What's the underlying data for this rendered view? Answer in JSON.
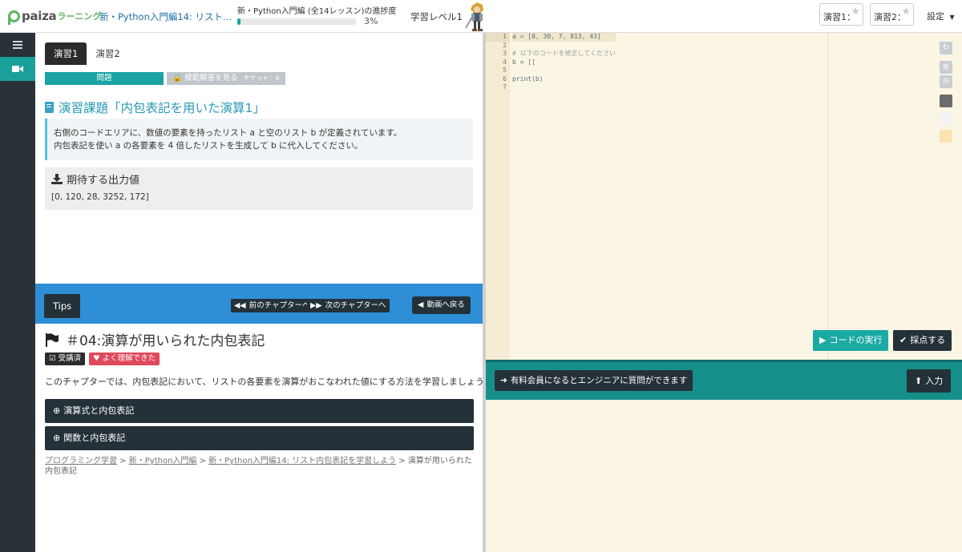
{
  "header": {
    "logo_text": "paiza",
    "logo_sub": "ラーニング",
    "course_title": "新・Python入門編14: リスト…",
    "progress_label": "新・Python入門編 (全14レッスン)の進捗度",
    "progress_percent": "3%",
    "progress_value": 0.03,
    "level_label": "学習レベル1",
    "exercise_badges": [
      "演習1：",
      "演習2："
    ],
    "settings_label": "設定"
  },
  "leftnav": {
    "icons": [
      "menu-icon",
      "video-icon"
    ]
  },
  "exercise": {
    "tabs": [
      "演習1",
      "演習2"
    ],
    "problem_label": "問題",
    "answer_label": "模範解答を見る",
    "ticket_label": "チケット：6",
    "heading": "演習課題「内包表記を用いた演算1」",
    "description_line1": "右側のコードエリアに、数値の要素を持ったリスト a と空のリスト b が定義されています。",
    "description_line2": "内包表記を使い a の各要素を 4 倍したリストを生成して b に代入してください。",
    "output_title": "期待する出力値",
    "output_value": "[0, 120, 28, 3252, 172]"
  },
  "tips": {
    "tips_label": "Tips",
    "prev_label": "前のチャプターへ",
    "next_label": "次のチャプターへ",
    "video_label": "動画へ戻る"
  },
  "chapter": {
    "title": "＃04:演算が用いられた内包表記",
    "badge_done": "受講済",
    "badge_good": "よく理解できた",
    "description": "このチャプターでは、内包表記において、リストの各要素を演算がおこなわれた値にする方法を学習しましょう。",
    "accordion": [
      "演算式と内包表記",
      "関数と内包表記"
    ],
    "breadcrumb": {
      "link1": "プログラミング学習",
      "sep": " > ",
      "link2": "新・Python入門編",
      "link3": "新・Python入門編14: リスト内包表記を学習しよう",
      "current": "演算が用いられた内包表記"
    }
  },
  "editor": {
    "line_numbers": [
      "1",
      "2",
      "3",
      "4",
      "5",
      "6",
      "7"
    ],
    "code_lines": [
      "a = [0, 30, 7, 813, 43]",
      "",
      "# 以下のコードを修正してください",
      "b = []",
      "",
      "print(b)",
      ""
    ],
    "run_label": "コードの実行",
    "grade_label": "採点する",
    "swatch_colors": [
      "#6b6b6b",
      "#f3f3f3",
      "#fde3b0"
    ]
  },
  "console": {
    "paid_label": "有料会員になるとエンジニアに質問ができます",
    "input_label": "入力"
  }
}
